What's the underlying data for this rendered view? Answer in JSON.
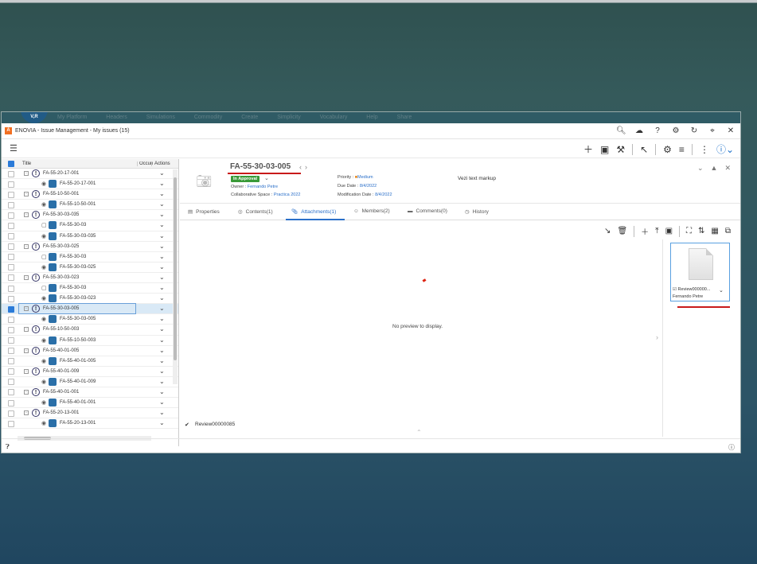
{
  "ghost_bar": {
    "logo": "V,R",
    "menu": [
      "My Platform",
      "Headers",
      "Simulations",
      "Commodity",
      "Create",
      "Simplicity",
      "Vocabulary",
      "Help",
      "Share"
    ]
  },
  "app": {
    "title": "ENOVIA - Issue Management - My issues (15)",
    "logo": "A"
  },
  "titlebar_icons": [
    "search-icon",
    "cloud-icon",
    "help-icon",
    "gear-icon",
    "refresh-icon",
    "pin-icon",
    "close-icon"
  ],
  "tree": {
    "headers": {
      "title": "Title",
      "occurrence": "Occurr",
      "actions": "Actions"
    },
    "rows": [
      {
        "level": 0,
        "text": "FA-55-20-17-001",
        "selected": false
      },
      {
        "level": 1,
        "text": "FA-55-20-17-001",
        "selected": false
      },
      {
        "level": 0,
        "text": "FA-55-10-50-001",
        "selected": false
      },
      {
        "level": 1,
        "text": "FA-55-10-50-001",
        "selected": false
      },
      {
        "level": 0,
        "text": "FA-55-30-03-035",
        "selected": false
      },
      {
        "level": 2,
        "text": "FA-55-30-03",
        "selected": false
      },
      {
        "level": 1,
        "text": "FA-55-30-03-035",
        "selected": false
      },
      {
        "level": 0,
        "text": "FA-55-30-03-025",
        "selected": false
      },
      {
        "level": 2,
        "text": "FA-55-30-03",
        "selected": false
      },
      {
        "level": 1,
        "text": "FA-55-30-03-025",
        "selected": false
      },
      {
        "level": 0,
        "text": "FA-55-30-03-023",
        "selected": false
      },
      {
        "level": 2,
        "text": "FA-55-30-03",
        "selected": false
      },
      {
        "level": 1,
        "text": "FA-55-30-03-023",
        "selected": false
      },
      {
        "level": 0,
        "text": "FA-55-30-03-005",
        "selected": true
      },
      {
        "level": 1,
        "text": "FA-55-30-03-005",
        "selected": false
      },
      {
        "level": 0,
        "text": "FA-55-10-50-003",
        "selected": false
      },
      {
        "level": 1,
        "text": "FA-55-10-50-003",
        "selected": false
      },
      {
        "level": 0,
        "text": "FA-55-40-01-005",
        "selected": false
      },
      {
        "level": 1,
        "text": "FA-55-40-01-005",
        "selected": false
      },
      {
        "level": 0,
        "text": "FA-55-40-01-009",
        "selected": false
      },
      {
        "level": 1,
        "text": "FA-55-40-01-009",
        "selected": false
      },
      {
        "level": 0,
        "text": "FA-55-40-01-001",
        "selected": false
      },
      {
        "level": 1,
        "text": "FA-55-40-01-001",
        "selected": false
      },
      {
        "level": 0,
        "text": "FA-55-20-13-001",
        "selected": false
      },
      {
        "level": 1,
        "text": "FA-55-20-13-001",
        "selected": false
      }
    ]
  },
  "issue": {
    "id": "FA-55-30-03-005",
    "state": "In Approval",
    "owner_label": "Owner :",
    "owner": "Fernando Petre",
    "space_label": "Collaborative Space :",
    "space": "Practica 2022",
    "priority_label": "Priority :",
    "priority": "Medium",
    "due_label": "Due Date :",
    "due": "8/4/2022",
    "mod_label": "Modification Date :",
    "mod": "8/4/2022",
    "description": "Vezi text markup"
  },
  "tabs": [
    {
      "label": "Properties",
      "icon": "properties-icon",
      "active": false
    },
    {
      "label": "Contents(1)",
      "icon": "pin-icon",
      "active": false
    },
    {
      "label": "Attachments(1)",
      "icon": "paperclip-icon",
      "active": true
    },
    {
      "label": "Members(2)",
      "icon": "members-icon",
      "active": false
    },
    {
      "label": "Comments(0)",
      "icon": "comments-icon",
      "active": false
    },
    {
      "label": "History",
      "icon": "history-icon",
      "active": false
    }
  ],
  "attachments": {
    "no_preview": "No preview to display.",
    "list": [
      {
        "name": "Review00000085",
        "checked": true
      }
    ],
    "thumb": {
      "name": "Review000000...",
      "owner": "Fernando Petre"
    }
  },
  "colors": {
    "accent": "#2a6fc9",
    "state_green": "#3a9a38",
    "annotation_red": "#c81a1a"
  }
}
